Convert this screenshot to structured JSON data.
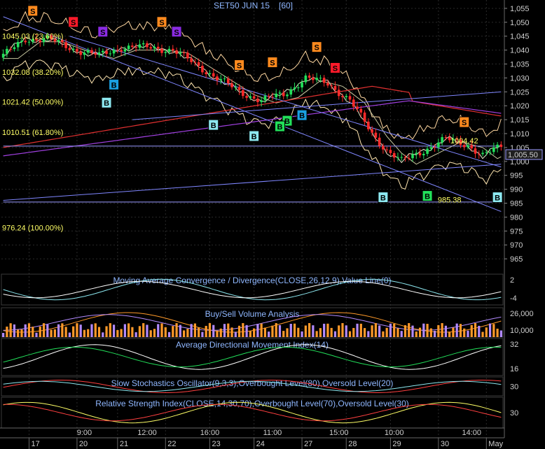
{
  "chart_data": {
    "type": "candlestick",
    "title": "SET50 JUN 15",
    "period": "[60]",
    "y_axis": {
      "ylim": [
        960,
        1058
      ],
      "ticks": [
        965,
        970,
        975,
        980,
        985,
        990,
        995,
        1000,
        1005,
        1010,
        1015,
        1020,
        1025,
        1030,
        1035,
        1040,
        1045,
        1050,
        1055
      ],
      "tick_labels": [
        "965",
        "970",
        "975",
        "980",
        "985",
        "990",
        "995",
        "1,000",
        "1,005",
        "1,010",
        "1,015",
        "1,020",
        "1,025",
        "1,030",
        "1,035",
        "1,040",
        "1,045",
        "1,050",
        "1,055"
      ]
    },
    "last_price": {
      "label": "1,005.50",
      "value": 1005.5
    },
    "fibonacci": [
      {
        "label": "1045.03 (23.60%)",
        "value": 1045.03
      },
      {
        "label": "1032.08 (38.20%)",
        "value": 1032.08
      },
      {
        "label": "1021.42 (50.00%)",
        "value": 1021.42
      },
      {
        "label": "1010.51 (61.80%)",
        "value": 1010.51
      },
      {
        "label": "976.24 (100.00%)",
        "value": 976.24
      }
    ],
    "annotations": [
      {
        "text": "1004.42",
        "x": 125,
        "y": 1007.5
      },
      {
        "text": "985.38",
        "x": 121,
        "y": 986.3
      }
    ],
    "x_axis": {
      "count": 136,
      "time_labels": [
        {
          "x": 22,
          "label": "9:00"
        },
        {
          "x": 39,
          "label": "12:00"
        },
        {
          "x": 56,
          "label": "16:00"
        },
        {
          "x": 73,
          "label": "11:00"
        },
        {
          "x": 91,
          "label": "15:00"
        },
        {
          "x": 106,
          "label": "10:00"
        },
        {
          "x": 127,
          "label": "14:00"
        }
      ],
      "date_labels": [
        {
          "x": 7,
          "label": "17"
        },
        {
          "x": 20,
          "label": "20"
        },
        {
          "x": 31,
          "label": "21"
        },
        {
          "x": 44,
          "label": "22"
        },
        {
          "x": 56,
          "label": "23"
        },
        {
          "x": 68,
          "label": "24"
        },
        {
          "x": 81,
          "label": "27"
        },
        {
          "x": 93,
          "label": "28"
        },
        {
          "x": 105,
          "label": "29"
        },
        {
          "x": 118,
          "label": "30"
        },
        {
          "x": 131,
          "label": "May"
        }
      ]
    },
    "trend_lines": [
      {
        "from": [
          0,
          1052
        ],
        "to": [
          135,
          982
        ],
        "color": "#7f86ff"
      },
      {
        "from": [
          18,
          1045
        ],
        "to": [
          135,
          998
        ],
        "color": "#7f86ff"
      },
      {
        "from": [
          0,
          986
        ],
        "to": [
          135,
          999
        ],
        "color": "#7f86ff"
      },
      {
        "from": [
          35,
          1015
        ],
        "to": [
          135,
          1025
        ],
        "color": "#7f86ff"
      },
      {
        "from": [
          0,
          1005.5
        ],
        "to": [
          135,
          1005.5
        ],
        "color": "#9a9aff"
      },
      {
        "from": [
          0,
          985.4
        ],
        "to": [
          135,
          985.4
        ],
        "color": "#9a9aff"
      }
    ],
    "signals": [
      {
        "type": "S",
        "x": 8,
        "price": 1054,
        "color": "#ff8a1e"
      },
      {
        "type": "S",
        "x": 19,
        "price": 1050,
        "color": "#ff1a2a"
      },
      {
        "type": "S",
        "x": 27,
        "price": 1046.5,
        "color": "#8a2be2"
      },
      {
        "type": "S",
        "x": 43,
        "price": 1050,
        "color": "#ff8a1e"
      },
      {
        "type": "S",
        "x": 47,
        "price": 1046.5,
        "color": "#8a2be2"
      },
      {
        "type": "S",
        "x": 64,
        "price": 1034.5,
        "color": "#ff8a1e"
      },
      {
        "type": "S",
        "x": 73,
        "price": 1035.5,
        "color": "#ff8a1e"
      },
      {
        "type": "S",
        "x": 85,
        "price": 1041,
        "color": "#ff8a1e"
      },
      {
        "type": "S",
        "x": 90,
        "price": 1033.5,
        "color": "#ff1a2a"
      },
      {
        "type": "S",
        "x": 125,
        "price": 1014,
        "color": "#ff8a1e"
      },
      {
        "type": "B",
        "x": 30,
        "price": 1027.5,
        "color": "#1a9fe0"
      },
      {
        "type": "B",
        "x": 28,
        "price": 1021,
        "color": "#8de8f0"
      },
      {
        "type": "B",
        "x": 57,
        "price": 1013,
        "color": "#8de8f0"
      },
      {
        "type": "B",
        "x": 68,
        "price": 1009,
        "color": "#8de8f0"
      },
      {
        "type": "B",
        "x": 77,
        "price": 1014.5,
        "color": "#22e05a"
      },
      {
        "type": "B",
        "x": 75,
        "price": 1012.5,
        "color": "#22e05a"
      },
      {
        "type": "B",
        "x": 81,
        "price": 1016.5,
        "color": "#1a9fe0"
      },
      {
        "type": "B",
        "x": 103,
        "price": 987,
        "color": "#8de8f0"
      },
      {
        "type": "B",
        "x": 115,
        "price": 987.5,
        "color": "#22e05a"
      },
      {
        "type": "B",
        "x": 134,
        "price": 987,
        "color": "#8de8f0"
      }
    ],
    "panels": [
      {
        "title": "Moving Average Convergence / Divergence(CLOSE,26,12,9),Value Line(0)",
        "tick_labels": [
          "2",
          "-4"
        ]
      },
      {
        "title": "Buy/Sell Volume Analysis",
        "tick_labels": [
          "26,000",
          "10,000"
        ]
      },
      {
        "title": "Average Directional Movement Index(14)",
        "tick_labels": [
          "32",
          "16"
        ]
      },
      {
        "title": "Slow Stochastics Oscillator(9,3,3),Overbought Level(80),Oversold Level(20)",
        "tick_labels": [
          "30"
        ]
      },
      {
        "title": "Relative Strength Index(CLOSE,14,30,70),Overbought Level(70),Oversold Level(30)",
        "tick_labels": [
          "30"
        ]
      }
    ]
  }
}
